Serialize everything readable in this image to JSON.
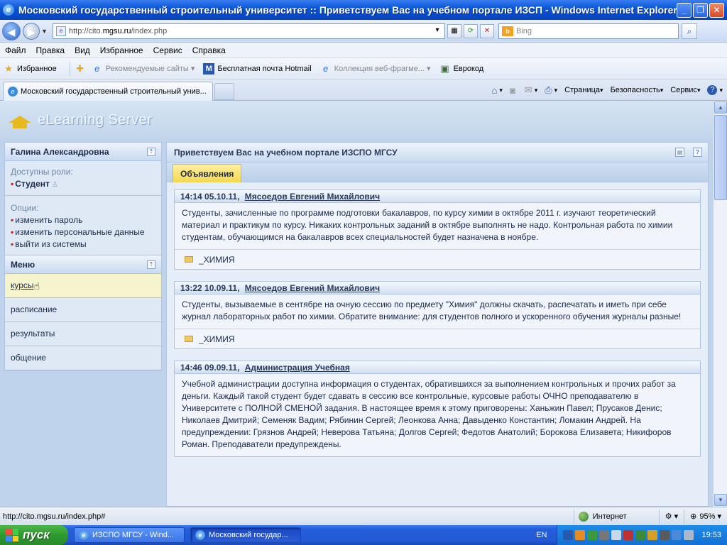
{
  "window": {
    "title": "Московский государственный строительный университет :: Приветствуем Вас на учебном портале ИЗСП - Windows Internet Explorer"
  },
  "address": {
    "url_prefix": "http://cito.",
    "url_host": "mgsu.ru",
    "url_path": "/index.php",
    "search_placeholder": "Bing"
  },
  "menubar": [
    "Файл",
    "Правка",
    "Вид",
    "Избранное",
    "Сервис",
    "Справка"
  ],
  "favorites": {
    "label": "Избранное",
    "items": [
      {
        "label": "Рекомендуемые сайты ▾",
        "icon": "ie-icon",
        "grey": true
      },
      {
        "label": "Бесплатная почта Hotmail",
        "icon": "msn-icon",
        "grey": false
      },
      {
        "label": "Коллекция веб-фрагме... ▾",
        "icon": "ie-icon",
        "grey": true
      },
      {
        "label": "Еврокод",
        "icon": "book-icon",
        "grey": false
      }
    ]
  },
  "tab": {
    "label": "Московский государственный строительный унив..."
  },
  "commandbar": {
    "page": "Страница",
    "security": "Безопасность",
    "tools": "Сервис"
  },
  "site": {
    "logo": "eLearning Server"
  },
  "sidebar": {
    "user_name": "Галина  Александровна",
    "roles_caption": "Доступны роли:",
    "role": "Студент",
    "options_caption": "Опции:",
    "options": [
      "изменить пароль",
      "изменить персональные данные",
      "выйти из системы"
    ],
    "menu_title": "Меню",
    "menu_items": [
      "курсы",
      "расписание",
      "результаты",
      "общение"
    ]
  },
  "main": {
    "title": "Приветствуем Вас на учебном портале ИЗСПО МГСУ",
    "tab": "Объявления",
    "posts": [
      {
        "date": "14:14 05.10.11,",
        "author": "Мясоедов Евгений Михайлович",
        "text": "Студенты, зачисленные по программе подготовки бакалавров, по курсу химии в октябре 2011 г. изучают теоретический материал и практикум по курсу. Никаких контрольных заданий в октябре выполнять не надо. Контрольная работа по химии студентам, обучающимся на бакалавров всех специальностей будет назначена в ноябре.",
        "tag": "_ХИМИЯ"
      },
      {
        "date": "13:22 10.09.11,",
        "author": "Мясоедов Евгений Михайлович",
        "text": "Студенты, вызываемые в сентябре на очную сессию по предмету \"Химия\" должны скачать, распечатать и иметь при себе журнал лабораторных работ по химии. Обратите внимание: для студентов полного и ускоренного обучения журналы разные!",
        "tag": "_ХИМИЯ"
      },
      {
        "date": "14:46 09.09.11,",
        "author": "Администрация Учебная",
        "text": "Учебной администрации доступна информация о студентах, обратившихся за выполнением контрольных и прочих работ за деньги. Каждый такой студент будет сдавать в сессию все контрольные, курсовые работы ОЧНО преподавателю в Университете с ПОЛНОЙ СМЕНОЙ задания. В настоящее время к этому приговорены: Ханьжин Павел; Прусаков Денис; Николаев Дмитрий; Семеняк Вадим; Рябинин Сергей; Леонкова Анна; Давыденко Константин; Ломакин Андрей. На предупреждении: Грязнов Андрей; Неверова Татьяна; Долгов Сергей; Федотов Анатолий; Борокова Елизавета; Никифоров Роман. Преподаватели предупреждены.",
        "tag": ""
      }
    ]
  },
  "status": {
    "url": "http://cito.mgsu.ru/index.php#",
    "zone": "Интернет",
    "zoom": "95%"
  },
  "taskbar": {
    "start": "пуск",
    "buttons": [
      "ИЗСПО МГСУ - Wind...",
      "Московский государ..."
    ],
    "lang": "EN",
    "clock": "19:53"
  }
}
